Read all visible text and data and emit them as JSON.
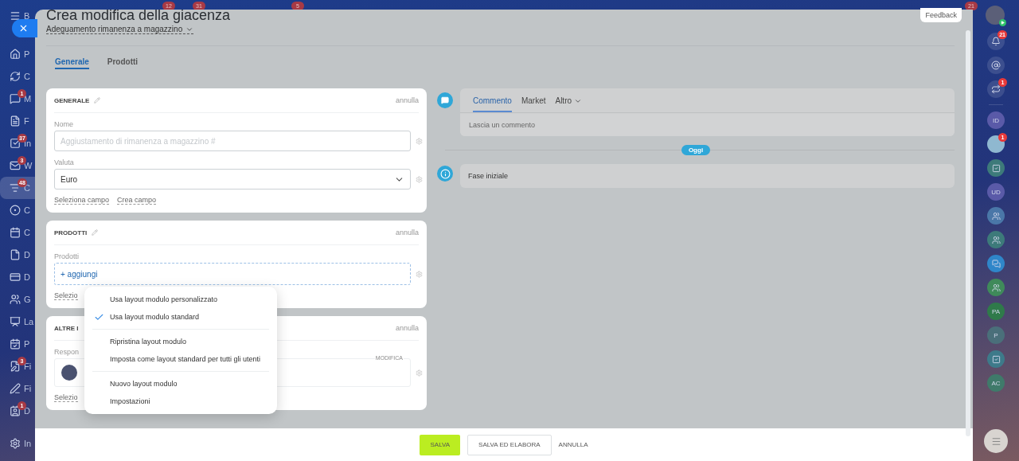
{
  "top_counters": [
    "12",
    "31",
    "5",
    "21"
  ],
  "left_nav": {
    "brand": "B",
    "items": [
      {
        "label": "P",
        "selected": false
      },
      {
        "label": "C",
        "selected": false
      },
      {
        "label": "M",
        "badge": "1",
        "selected": false
      },
      {
        "label": "F",
        "selected": false
      },
      {
        "label": "In",
        "badge": "37",
        "selected": false
      },
      {
        "label": "W",
        "badge": "3",
        "selected": false
      },
      {
        "label": "C",
        "badge": "48",
        "selected": true
      },
      {
        "label": "C",
        "selected": false
      },
      {
        "label": "C",
        "selected": false
      },
      {
        "label": "D",
        "selected": false
      },
      {
        "label": "D",
        "selected": false
      },
      {
        "label": "G",
        "selected": false
      },
      {
        "label": "La",
        "selected": false
      },
      {
        "label": "P",
        "selected": false
      },
      {
        "label": "Fi",
        "badge": "3",
        "selected": false
      },
      {
        "label": "Fi",
        "selected": false
      },
      {
        "label": "D",
        "badge": "1",
        "selected": false
      }
    ],
    "settings": "In"
  },
  "panel": {
    "title": "Crea modifica della giacenza",
    "subtitle": "Adeguamento rimanenza a magazzino",
    "feedback": "Feedback",
    "tabs": [
      {
        "label": "Generale",
        "selected": true
      },
      {
        "label": "Prodotti",
        "selected": false
      }
    ],
    "cards": [
      {
        "title": "GENERALE",
        "editable": true,
        "action": "annulla",
        "fields": [
          {
            "label": "Nome",
            "kind": "text",
            "placeholder": "Aggiustamento di rimanenza a magazzino #"
          },
          {
            "label": "Valuta",
            "kind": "select",
            "value": "Euro"
          }
        ],
        "links": [
          "Seleziona campo",
          "Crea campo"
        ]
      },
      {
        "title": "PRODOTTI",
        "editable": true,
        "action": "annulla",
        "fields": [
          {
            "label": "Prodotti",
            "kind": "add",
            "value": "+ aggiungi"
          }
        ],
        "links": [
          "Selezio"
        ]
      },
      {
        "title": "ALTRE I",
        "editable": false,
        "action": "annulla",
        "fields": [
          {
            "label": "Respon",
            "kind": "user",
            "tag": "MODIFICA"
          }
        ],
        "links": [
          "Selezio"
        ]
      }
    ],
    "timeline": {
      "tabs": [
        {
          "label": "Commento",
          "selected": true
        },
        {
          "label": "Market",
          "selected": false
        },
        {
          "label": "Altro",
          "selected": false
        }
      ],
      "placeholder": "Lascia un commento",
      "date": "Oggi",
      "events": [
        "Fase iniziale"
      ]
    },
    "menu": {
      "groups": [
        {
          "items": [
            {
              "label": "Usa layout modulo personalizzato",
              "checked": false
            },
            {
              "label": "Usa layout modulo standard",
              "checked": true
            }
          ]
        },
        {
          "items": [
            {
              "label": "Ripristina layout modulo",
              "checked": false
            },
            {
              "label": "Imposta come layout standard per tutti gli utenti",
              "checked": false
            }
          ]
        },
        {
          "items": [
            {
              "label": "Nuovo layout modulo",
              "checked": false
            },
            {
              "label": "Impostazioni",
              "checked": false
            }
          ]
        }
      ]
    },
    "footer": [
      {
        "label": "SALVA",
        "kind": "primary"
      },
      {
        "label": "SALVA ED ELABORA",
        "kind": "secondary"
      },
      {
        "label": "ANNULLA",
        "kind": "link"
      }
    ]
  },
  "right_rail": {
    "top": [
      {
        "kind": "avatar"
      },
      {
        "kind": "icon",
        "badge": "21"
      },
      {
        "kind": "icon"
      },
      {
        "kind": "icon",
        "badge": "1"
      }
    ],
    "chats": [
      {
        "kind": "initials",
        "text": "ID",
        "color": "#5a5aa8"
      },
      {
        "kind": "avatar",
        "badge": "1",
        "color": "#8fb8d0"
      },
      {
        "kind": "icon",
        "color": "#3d7a7a"
      },
      {
        "kind": "initials",
        "text": "UD",
        "color": "#5a5aa8"
      },
      {
        "kind": "icon",
        "color": "#4a77a8"
      },
      {
        "kind": "icon",
        "color": "#3d7a7a"
      },
      {
        "kind": "icon",
        "color": "#2f86c9"
      },
      {
        "kind": "icon",
        "color": "#3f8a5a"
      },
      {
        "kind": "initials",
        "text": "PA",
        "color": "#2f7a4a"
      },
      {
        "kind": "initials",
        "text": "P",
        "color": "#4a6f7a"
      },
      {
        "kind": "icon",
        "color": "#3d7a8a"
      },
      {
        "kind": "initials",
        "text": "AC",
        "color": "#3f7a6a"
      }
    ]
  }
}
